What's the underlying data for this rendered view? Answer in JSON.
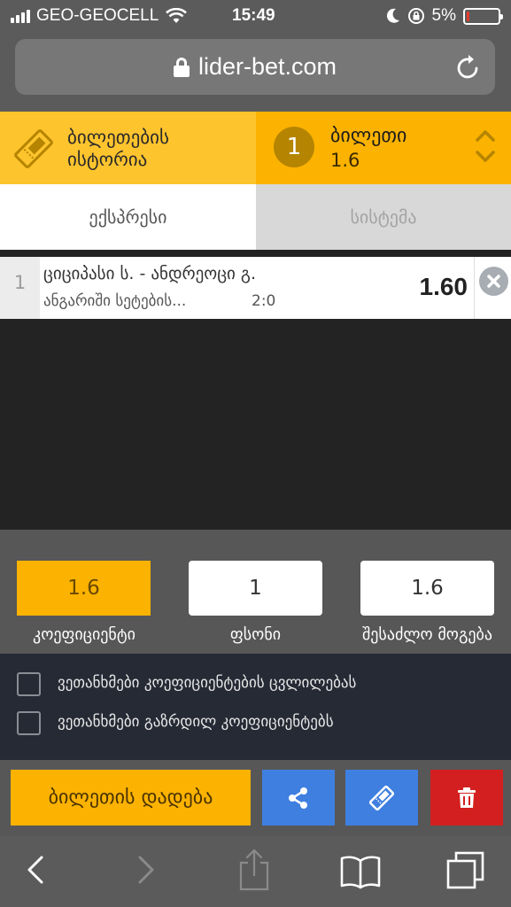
{
  "status_bar": {
    "carrier": "GEO-GEOCELL",
    "time": "15:49",
    "battery": "5%",
    "battery_level": 0.05
  },
  "browser": {
    "url": "lider-bet.com"
  },
  "header": {
    "history_label_line1": "ბილეთების",
    "history_label_line2": "ისტორია",
    "ticket_count": "1",
    "ticket_label": "ბილეთი",
    "ticket_odds": "1.6"
  },
  "tabs": [
    {
      "label": "ექსპრესი"
    },
    {
      "label": "სისტემა"
    }
  ],
  "bets": [
    {
      "index": "1",
      "teams": "ციციპასი ს. - ანდრეოცი გ.",
      "market": "ანგარიში სეტების...",
      "score": "2:0",
      "odd": "1.60"
    }
  ],
  "stake": {
    "coefficient_value": "1.6",
    "stake_value": "1",
    "possible_win_value": "1.6",
    "coefficient_label": "კოეფიციენტი",
    "stake_label": "ფსონი",
    "possible_win_label": "შესაძლო მოგება"
  },
  "agreements": [
    "ვეთანხმები კოეფიციენტების ცვლილებას",
    "ვეთანხმები გაზრდილ კოეფიციენტებს"
  ],
  "actions": {
    "place_bet_label": "ბილეთის დადება"
  },
  "icons": {
    "ticket": "ticket-icon",
    "share": "share-icon",
    "delete": "trash-icon",
    "remove": "close-icon"
  },
  "colors": {
    "accent_yellow": "#fbb200",
    "light_yellow": "#fec42e",
    "blue": "#3f7fe0",
    "red": "#d31f1f"
  }
}
